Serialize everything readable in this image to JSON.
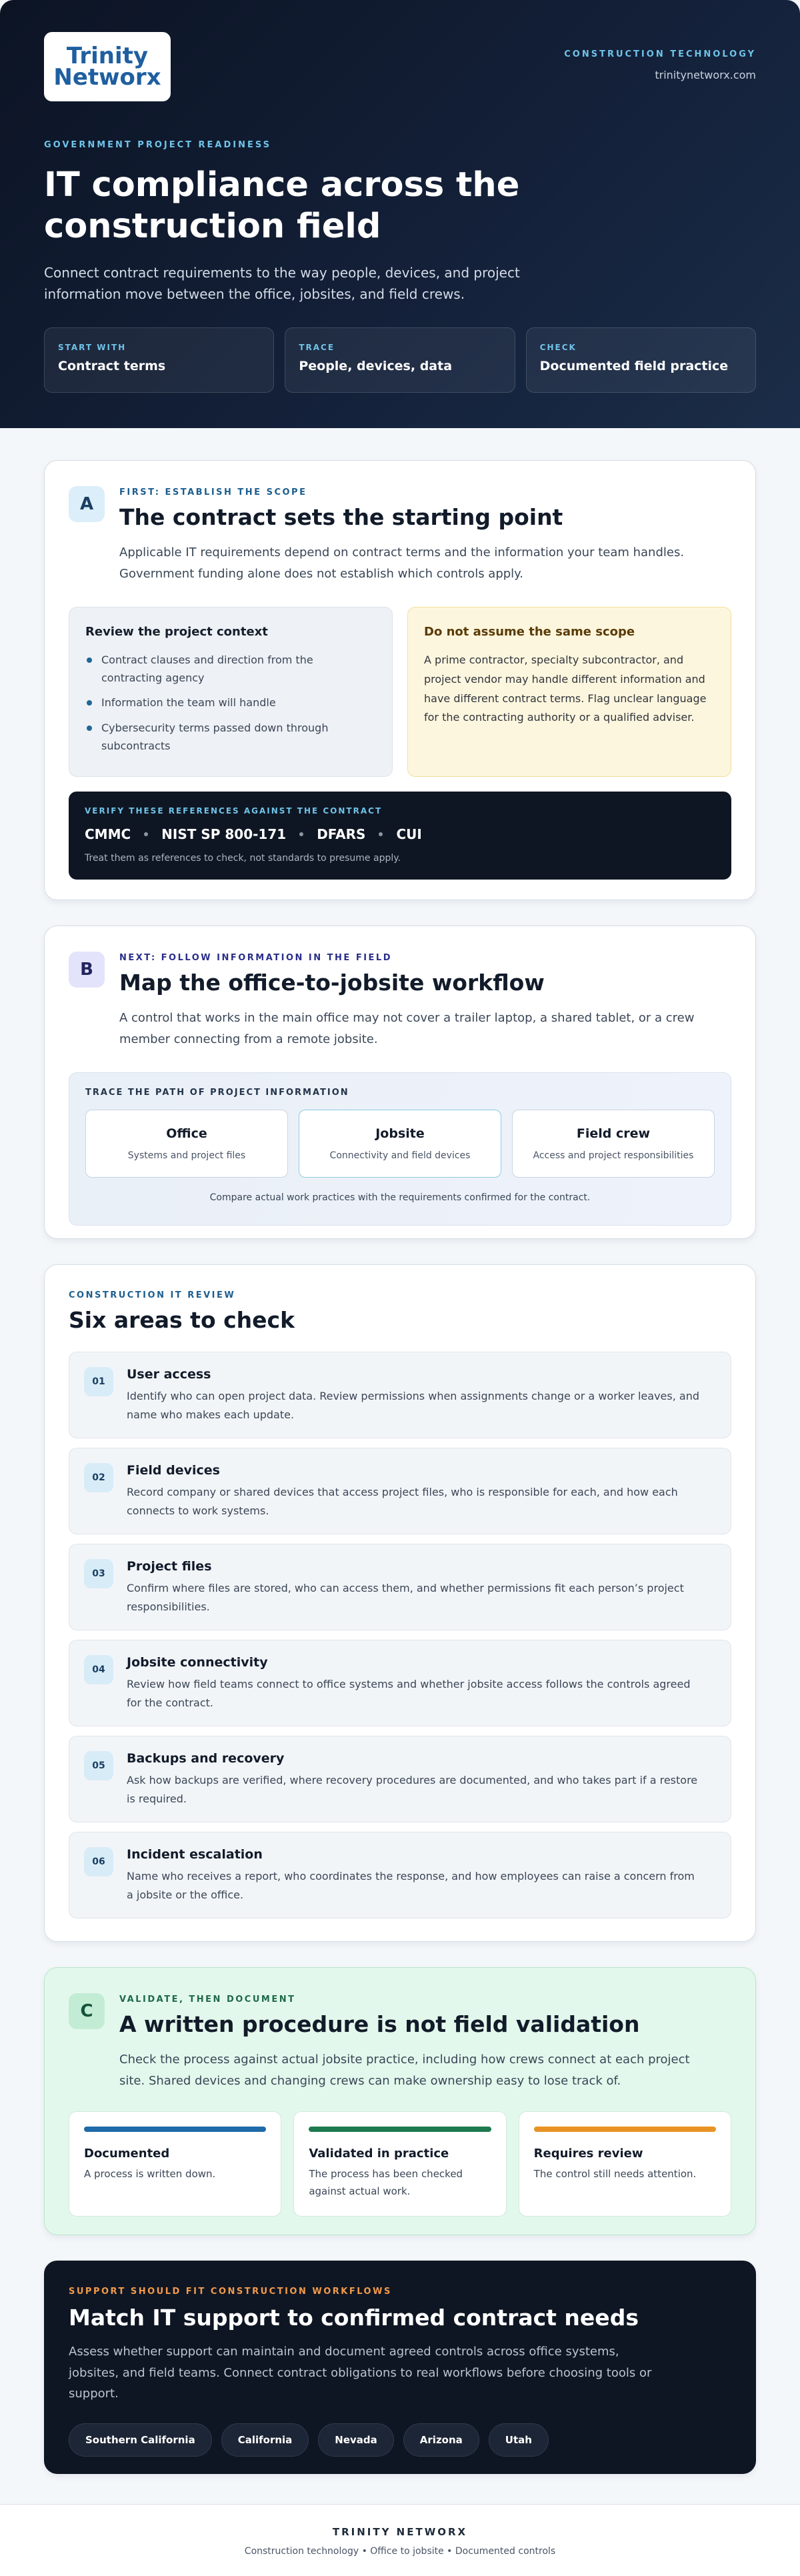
{
  "hero": {
    "logo_text_1": "Trinity",
    "logo_text_2": "Networx",
    "top_eyebrow": "CONSTRUCTION TECHNOLOGY",
    "site": "trinitynetworx.com",
    "eyebrow": "GOVERNMENT PROJECT READINESS",
    "title": "IT compliance across the construction field",
    "subtitle": "Connect contract requirements to the way people, devices, and project information move between the office, jobsites, and field crews.",
    "cards": [
      {
        "label": "START WITH",
        "value": "Contract terms"
      },
      {
        "label": "TRACE",
        "value": "People, devices, data"
      },
      {
        "label": "CHECK",
        "value": "Documented field practice"
      }
    ]
  },
  "section_a": {
    "badge": "A",
    "eyebrow": "FIRST: ESTABLISH THE SCOPE",
    "title": "The contract sets the starting point",
    "body": "Applicable IT requirements depend on contract terms and the information your team handles. Government funding alone does not establish which controls apply.",
    "review_title": "Review the project context",
    "review_items": [
      "Contract clauses and direction from the contracting agency",
      "Information the team will handle",
      "Cybersecurity terms passed down through subcontracts"
    ],
    "warn_title": "Do not assume the same scope",
    "warn_body": "A prime contractor, specialty subcontractor, and project vendor may handle different information and have different contract terms. Flag unclear language for the contracting authority or a qualified adviser.",
    "ref_label": "VERIFY THESE REFERENCES AGAINST THE CONTRACT",
    "refs": [
      "CMMC",
      "NIST SP 800-171",
      "DFARS",
      "CUI"
    ],
    "ref_note": "Treat them as references to check, not standards to presume apply."
  },
  "section_b": {
    "badge": "B",
    "eyebrow": "NEXT: FOLLOW INFORMATION IN THE FIELD",
    "title": "Map the office-to-jobsite workflow",
    "body": "A control that works in the main office may not cover a trailer laptop, a shared tablet, or a crew member connecting from a remote jobsite.",
    "trace_label": "TRACE THE PATH OF PROJECT INFORMATION",
    "cards": [
      {
        "title": "Office",
        "sub": "Systems and project files"
      },
      {
        "title": "Jobsite",
        "sub": "Connectivity and field devices"
      },
      {
        "title": "Field crew",
        "sub": "Access and project responsibilities"
      }
    ],
    "note": "Compare actual work practices with the requirements confirmed for the contract."
  },
  "six": {
    "eyebrow": "CONSTRUCTION IT REVIEW",
    "title": "Six areas to check",
    "areas": [
      {
        "num": "01",
        "title": "User access",
        "desc": "Identify who can open project data. Review permissions when assignments change or a worker leaves, and name who makes each update."
      },
      {
        "num": "02",
        "title": "Field devices",
        "desc": "Record company or shared devices that access project files, who is responsible for each, and how each connects to work systems."
      },
      {
        "num": "03",
        "title": "Project files",
        "desc": "Confirm where files are stored, who can access them, and whether permissions fit each person’s project responsibilities."
      },
      {
        "num": "04",
        "title": "Jobsite connectivity",
        "desc": "Review how field teams connect to office systems and whether jobsite access follows the controls agreed for the contract."
      },
      {
        "num": "05",
        "title": "Backups and recovery",
        "desc": "Ask how backups are verified, where recovery procedures are documented, and who takes part if a restore is required."
      },
      {
        "num": "06",
        "title": "Incident escalation",
        "desc": "Name who receives a report, who coordinates the response, and how employees can raise a concern from a jobsite or the office."
      }
    ]
  },
  "section_c": {
    "badge": "C",
    "eyebrow": "VALIDATE, THEN DOCUMENT",
    "title": "A written procedure is not field validation",
    "body": "Check the process against actual jobsite practice, including how crews connect at each project site. Shared devices and changing crews can make ownership easy to lose track of.",
    "statuses": [
      {
        "title": "Documented",
        "desc": "A process is written down.",
        "color": "#1f6aa8"
      },
      {
        "title": "Validated in practice",
        "desc": "The process has been checked against actual work.",
        "color": "#1e7a4f"
      },
      {
        "title": "Requires review",
        "desc": "The control still needs attention.",
        "color": "#e89324"
      }
    ]
  },
  "section_d": {
    "eyebrow": "SUPPORT SHOULD FIT CONSTRUCTION WORKFLOWS",
    "title": "Match IT support to confirmed contract needs",
    "body": "Assess whether support can maintain and document agreed controls across office systems, jobsites, and field teams. Connect contract obligations to real workflows before choosing tools or support.",
    "regions": [
      "Southern California",
      "California",
      "Nevada",
      "Arizona",
      "Utah"
    ]
  },
  "footer": {
    "title": "TRINITY NETWORX",
    "sub": "Construction technology • Office to jobsite • Documented controls"
  }
}
